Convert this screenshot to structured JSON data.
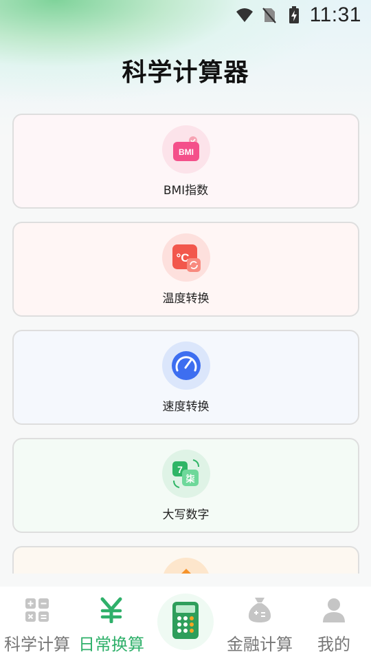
{
  "status_bar": {
    "time": "11:31"
  },
  "header": {
    "title": "科学计算器"
  },
  "cards": [
    {
      "label": "BMI指数",
      "icon_text": "BMI",
      "icon": "bmi-icon"
    },
    {
      "label": "温度转换",
      "icon_text": "°C",
      "icon": "temperature-icon"
    },
    {
      "label": "速度转换",
      "icon": "speedometer-icon"
    },
    {
      "label": "大写数字",
      "icon_text_a": "7",
      "icon_text_b": "柒",
      "icon": "uppercase-number-icon"
    },
    {
      "label": "",
      "icon": "orange-diamond-icon"
    }
  ],
  "tabbar": {
    "items": [
      {
        "label": "科学计算",
        "icon": "calculator-grid-icon",
        "active": false
      },
      {
        "label": "日常换算",
        "icon": "yen-icon",
        "active": true
      },
      {
        "label": "",
        "icon": "calculator-center-icon"
      },
      {
        "label": "金融计算",
        "icon": "money-bag-icon",
        "active": false
      },
      {
        "label": "我的",
        "icon": "person-icon",
        "active": false
      }
    ]
  },
  "colors": {
    "accent": "#2fb06a",
    "inactive": "#7a7a7a",
    "card_bmi_bg": "#fef6f8",
    "card_temp_bg": "#fff6f5",
    "card_speed_bg": "#f5f8fd",
    "card_number_bg": "#f4fbf6",
    "card_5_bg": "#fdf8f1"
  }
}
